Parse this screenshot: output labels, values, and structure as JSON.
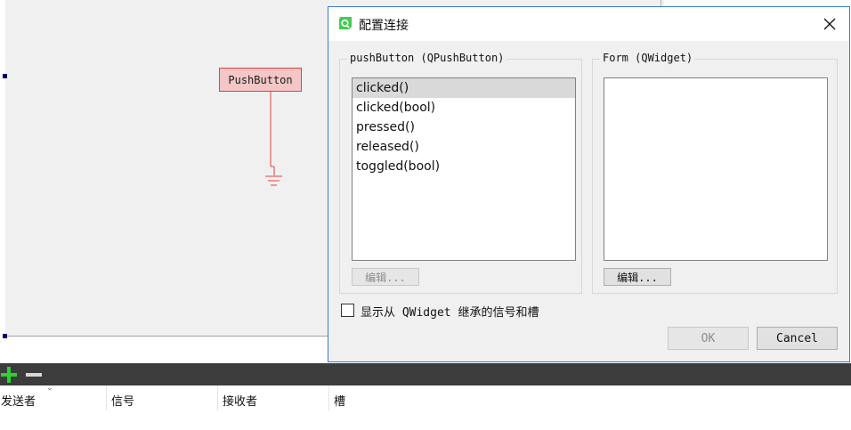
{
  "canvas": {
    "push_button_label": "PushButton"
  },
  "dialog": {
    "title": "配置连接",
    "close_icon": "close-icon",
    "app_icon": "qt-creator-icon",
    "left_group": {
      "label": "pushButton (QPushButton)",
      "items": [
        "clicked()",
        "clicked(bool)",
        "pressed()",
        "released()",
        "toggled(bool)"
      ],
      "selected_index": 0,
      "edit_label": "编辑..."
    },
    "right_group": {
      "label": "Form (QWidget)",
      "items": [],
      "edit_label": "编辑..."
    },
    "checkbox": {
      "label": "显示从 QWidget 继承的信号和槽",
      "checked": false
    },
    "ok_label": "OK",
    "cancel_label": "Cancel"
  },
  "toolbar": {
    "add_icon": "plus-icon",
    "remove_icon": "minus-icon"
  },
  "table": {
    "columns": [
      "发送者",
      "信号",
      "接收者",
      "槽"
    ]
  },
  "colors": {
    "button_fill": "#f4c6c6",
    "button_border": "#e04040",
    "dialog_border": "#3b7bc8",
    "add_green": "#2fd12f",
    "toolbar_bg": "#3c3c3c"
  }
}
